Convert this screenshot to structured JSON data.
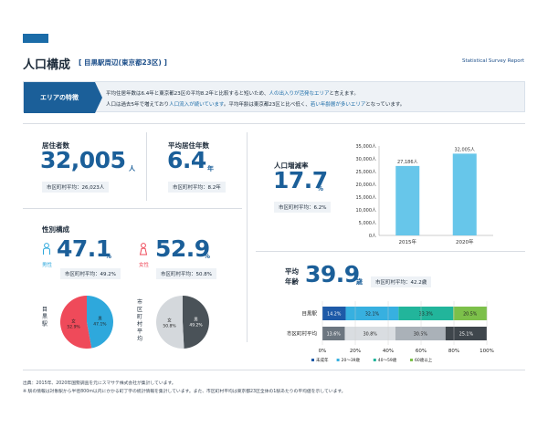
{
  "header": {
    "title": "人口構成",
    "subtitle": "[ 目黒駅周辺(東京都23区) ]",
    "survey_label": "Statistical Survey Report"
  },
  "feature": {
    "tag": "エリアの特徴",
    "line1_a": "平均住居年数は6.4年と東京都23区の平均8.2年と比較すると短いため、",
    "line1_b": "人の出入りが活発なエリア",
    "line1_c": "と言えます。",
    "line2_a": "人口は過去5年で増えており",
    "line2_b": "人口流入が続いています",
    "line2_c": "。平均年齢は東京都23区と比べ低く、",
    "line2_d": "若い年齢層が多いエリア",
    "line2_e": "となっています。"
  },
  "residents": {
    "label": "居住者数",
    "value": "32,005",
    "unit": "人",
    "avg": "市区町村平均：26,023人"
  },
  "years": {
    "label": "平均居住年数",
    "value": "6.4",
    "unit": "年",
    "avg": "市区町村平均：8.2年"
  },
  "growth": {
    "label": "人口増減率",
    "value": "17.7",
    "unit": "%",
    "avg": "市区町村平均：6.2%"
  },
  "gender": {
    "label": "性別構成",
    "male_label": "男性",
    "male_value": "47.1",
    "male_avg": "市区町村平均：49.2%",
    "female_label": "女性",
    "female_value": "52.9",
    "female_avg": "市区町村平均：50.8%",
    "unit": "%",
    "pie1_label": "目黒駅",
    "pie1_female": "女",
    "pie1_female_val": "52.9%",
    "pie1_male": "男",
    "pie1_male_val": "47.1%",
    "pie2_label": "市区町村平均",
    "pie2_female": "女",
    "pie2_female_val": "50.8%",
    "pie2_male": "男",
    "pie2_male_val": "49.2%",
    "colors": {
      "male": "#2ea8dc",
      "female": "#ef4a5a",
      "avg_male": "#4a5258",
      "avg_female": "#d4d8dc"
    }
  },
  "age": {
    "label_line1": "平均",
    "label_line2": "年齢",
    "value": "39.9",
    "unit": "歳",
    "avg": "市区町村平均：42.2歳"
  },
  "chart_data": [
    {
      "type": "bar",
      "categories": [
        "2015年",
        "2020年"
      ],
      "values": [
        27186,
        32005
      ],
      "data_labels": [
        "27,186人",
        "32,005人"
      ],
      "ytick_labels": [
        "0人",
        "5,000人",
        "10,000人",
        "15,000人",
        "20,000人",
        "25,000人",
        "30,000人",
        "35,000人"
      ],
      "ylim": [
        0,
        35000
      ],
      "color": "#67c6ea"
    },
    {
      "type": "bar",
      "stacked": true,
      "orientation": "horizontal",
      "categories": [
        "目黒駅",
        "市区町村平均"
      ],
      "series": [
        {
          "name": "未成年",
          "values": [
            14.2,
            13.6
          ],
          "labels": [
            "14.2%",
            "13.6%"
          ],
          "colors": [
            "#1e5aa8",
            "#6c7680"
          ]
        },
        {
          "name": "20〜39歳",
          "values": [
            32.1,
            30.8
          ],
          "labels": [
            "32.1%",
            "30.8%"
          ],
          "colors": [
            "#37b0e0",
            "#d9dde1"
          ]
        },
        {
          "name": "40〜59歳",
          "values": [
            33.3,
            30.5
          ],
          "labels": [
            "33.3%",
            "30.5%"
          ],
          "colors": [
            "#22b59b",
            "#aab1b8"
          ]
        },
        {
          "name": "60歳以上",
          "values": [
            20.5,
            25.1
          ],
          "labels": [
            "20.5%",
            "25.1%"
          ],
          "colors": [
            "#7cc04a",
            "#3f464c"
          ]
        }
      ],
      "xtick_labels": [
        "0%",
        "20%",
        "40%",
        "60%",
        "80%",
        "100%"
      ],
      "xlim": [
        0,
        100
      ]
    }
  ],
  "footnotes": {
    "line1": "出典：2015年、2020年国勢調査を元にスマサテ株式会社が集計しています。",
    "line2": "※ 駅の情報は対象駅から半径800m以内にかかる町丁字の統計情報を集計しています。また、市区町村平均は東京都23区全体の1駅あたりの平均値を示しています。"
  }
}
